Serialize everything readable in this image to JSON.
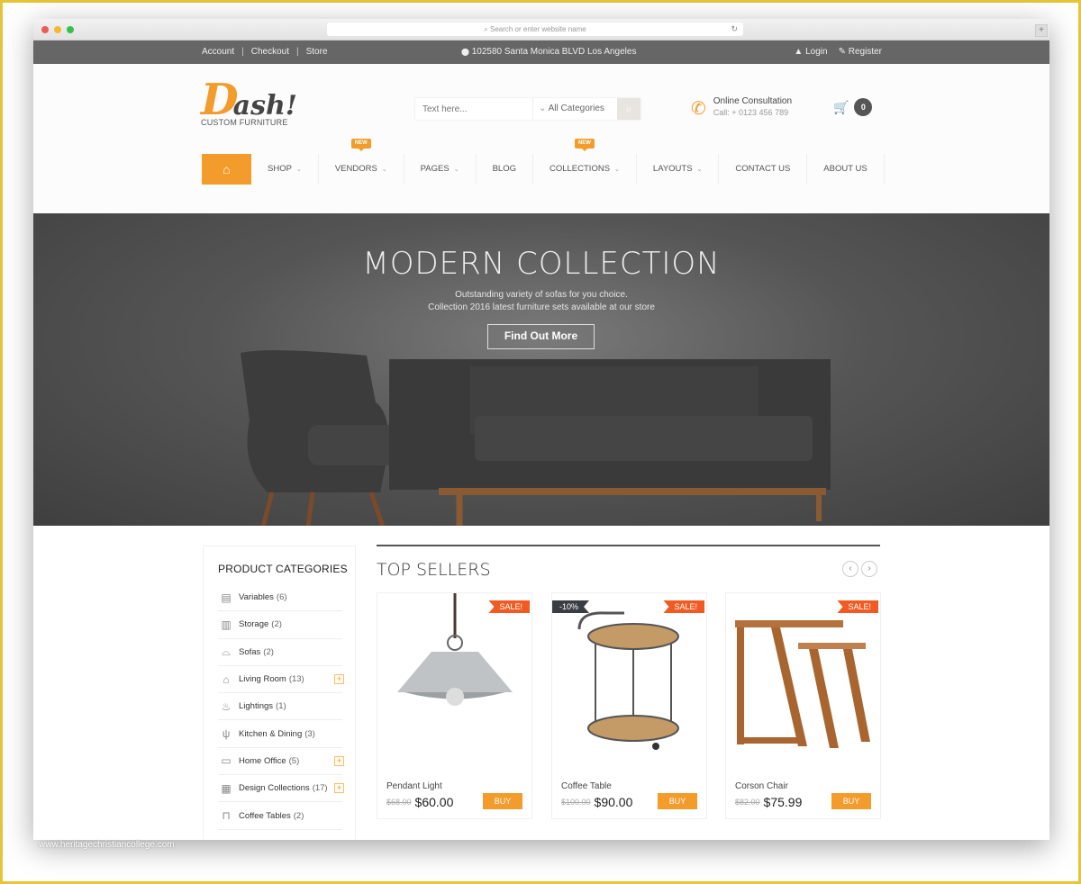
{
  "browser": {
    "url_placeholder": "Search or enter website name",
    "reload_icon": "↻",
    "new_tab_icon": "+",
    "traffic_lights": [
      "#ee5b50",
      "#f5b92e",
      "#35c04a"
    ]
  },
  "topbar": {
    "links": [
      "Account",
      "Checkout",
      "Store"
    ],
    "address_icon": "📍",
    "address": "102580 Santa Monica BLVD Los Angeles",
    "login_icon": "👤",
    "login": "Login",
    "register_icon": "✎",
    "register": "Register"
  },
  "header": {
    "logo_letter": "D",
    "logo_rest": "ash!",
    "logo_tagline": "CUSTOM FURNITURE",
    "search_placeholder": "Text here...",
    "category_select": "All Categories",
    "category_chevron": "⌄",
    "search_icon": "⌕",
    "consult_title": "Online Consultation",
    "consult_phone": "Call: + 0123 456 789",
    "phone_icon": "📞",
    "cart_icon": "🛒",
    "cart_count": "0"
  },
  "nav": {
    "home_icon": "⌂",
    "items": [
      {
        "label": "SHOP",
        "dropdown": true,
        "badge": ""
      },
      {
        "label": "VENDORS",
        "dropdown": true,
        "badge": "NEW"
      },
      {
        "label": "PAGES",
        "dropdown": true,
        "badge": ""
      },
      {
        "label": "BLOG",
        "dropdown": false,
        "badge": ""
      },
      {
        "label": "COLLECTIONS",
        "dropdown": true,
        "badge": "NEW"
      },
      {
        "label": "LAYOUTS",
        "dropdown": true,
        "badge": ""
      },
      {
        "label": "CONTACT US",
        "dropdown": false,
        "badge": ""
      },
      {
        "label": "ABOUT US",
        "dropdown": false,
        "badge": ""
      }
    ],
    "chevron": "⌄"
  },
  "hero": {
    "title": "MODERN COLLECTION",
    "line1": "Outstanding variety of sofas for you choice.",
    "line2": "Collection 2016 latest furniture sets available at our store",
    "button": "Find Out More"
  },
  "sidebar": {
    "title": "PRODUCT CATEGORIES",
    "categories": [
      {
        "name": "Variables",
        "count": "(6)",
        "icon": "▤",
        "expandable": false
      },
      {
        "name": "Storage",
        "count": "(2)",
        "icon": "▥",
        "expandable": false
      },
      {
        "name": "Sofas",
        "count": "(2)",
        "icon": "⌓",
        "expandable": false
      },
      {
        "name": "Living Room",
        "count": "(13)",
        "icon": "⌂",
        "expandable": true
      },
      {
        "name": "Lightings",
        "count": "(1)",
        "icon": "♨",
        "expandable": false
      },
      {
        "name": "Kitchen & Dining",
        "count": "(3)",
        "icon": "ψ",
        "expandable": false
      },
      {
        "name": "Home Office",
        "count": "(5)",
        "icon": "▭",
        "expandable": true
      },
      {
        "name": "Design Collections",
        "count": "(17)",
        "icon": "▦",
        "expandable": true
      },
      {
        "name": "Coffee Tables",
        "count": "(2)",
        "icon": "⊓",
        "expandable": false
      }
    ],
    "plus_icon": "+"
  },
  "top_sellers": {
    "title": "TOP SELLERS",
    "prev_icon": "‹",
    "next_icon": "›",
    "products": [
      {
        "name": "Pendant Light",
        "old_price": "$68.00",
        "price": "$60.00",
        "sale": "SALE!",
        "discount": "",
        "buy": "BUY"
      },
      {
        "name": "Coffee Table",
        "old_price": "$100.00",
        "price": "$90.00",
        "sale": "SALE!",
        "discount": "-10%",
        "buy": "BUY"
      },
      {
        "name": "Corson Chair",
        "old_price": "$82.00",
        "price": "$75.99",
        "sale": "SALE!",
        "discount": "",
        "buy": "BUY"
      }
    ]
  },
  "watermark": "www.heritagechristiancollege.com",
  "colors": {
    "accent": "#f39c2b",
    "sale": "#f15a22",
    "topbar": "#666666",
    "discount": "#3a3d44"
  }
}
